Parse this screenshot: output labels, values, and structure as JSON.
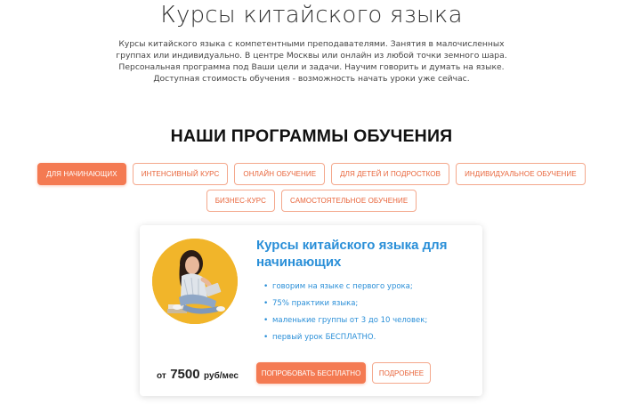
{
  "hero": {
    "title": "Курсы китайского языка",
    "description": "Курсы китайского языка с компетентными преподавателями. Занятия в малочисленных группах или индивидуально. В центре Москвы или онлайн из любой точки земного шара. Персональная программа под Ваши цели и задачи. Научим говорить и думать на языке. Доступная стоимость обучения - возможность начать уроки уже сейчас."
  },
  "programs": {
    "title": "НАШИ ПРОГРАММЫ ОБУЧЕНИЯ",
    "tabs_row1": [
      "ДЛЯ НАЧИНАЮЩИХ",
      "ИНТЕНСИВНЫЙ КУРС",
      "ОНЛАЙН ОБУЧЕНИЕ",
      "ДЛЯ ДЕТЕЙ И ПОДРОСТКОВ",
      "ИНДИВИДУАЛЬНОЕ ОБУЧЕНИЕ"
    ],
    "tabs_row2": [
      "БИЗНЕС-КУРС",
      "САМОСТОЯТЕЛЬНОЕ ОБУЧЕНИЕ"
    ],
    "active_tab": "ДЛЯ НАЧИНАЮЩИХ"
  },
  "card": {
    "title": "Курсы китайского языка для начинающих",
    "features": [
      "говорим на языке с первого урока;",
      "75% практики языка;",
      "маленькие группы от 3 до 10 человек;",
      "первый урок БЕСПЛАТНО."
    ],
    "price_from": "от",
    "price_amount": "7500",
    "price_unit": "руб/мес",
    "cta_primary": "ПОПРОБОВАТЬ БЕСПЛАТНО",
    "cta_secondary": "ПОДРОБНЕЕ",
    "photo_icon": "student-photo-icon"
  },
  "colors": {
    "accent": "#f47a52",
    "title_blue": "#2a8fd8",
    "photo_bg": "#f1b52a"
  }
}
